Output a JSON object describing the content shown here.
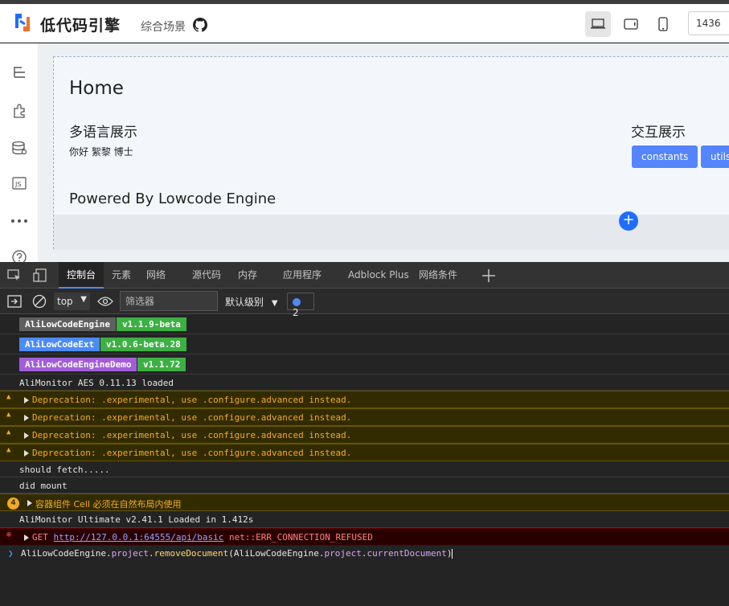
{
  "header": {
    "app_title": "低代码引擎",
    "scene_label": "综合场景",
    "canvas_width": "1436"
  },
  "canvas": {
    "home_title": "Home",
    "multilang_title": "多语言展示",
    "multilang_text": "你好  絮黎 博士",
    "interaction_title": "交互展示",
    "buttons": [
      "constants",
      "utils"
    ],
    "powered_text": "Powered By Lowcode Engine",
    "add_symbol": "+"
  },
  "devtools": {
    "tabs": [
      "控制台",
      "元素",
      "网络",
      "源代码",
      "内存",
      "应用程序",
      "Adblock Plus",
      "网络条件"
    ],
    "active_tab": "控制台",
    "context": "top",
    "filter_placeholder": "筛选器",
    "level": "默认级别",
    "issue_count": "2"
  },
  "console": {
    "badges": [
      {
        "name": "AliLowCodeEngine",
        "version": "v1.1.9-beta",
        "name_color": "#606060",
        "version_color": "#3cb043"
      },
      {
        "name": "AliLowCodeExt",
        "version": "v1.0.6-beta.28",
        "name_color": "#4c8bf5",
        "version_color": "#3cb043"
      },
      {
        "name": "AliLowCodeEngineDemo",
        "version": "v1.1.72",
        "name_color": "#a25ed8",
        "version_color": "#3cb043"
      }
    ],
    "monitor_aes": "AliMonitor AES 0.11.13 loaded",
    "deprecations": [
      "Deprecation: .experimental, use .configure.advanced instead.",
      "Deprecation: .experimental, use .configure.advanced instead.",
      "Deprecation: .experimental, use .configure.advanced instead.",
      "Deprecation: .experimental, use .configure.advanced instead."
    ],
    "should_fetch": "should fetch.....",
    "did_mount": "did mount",
    "grouped_warning_count": "4",
    "grouped_warning": "容器组件 Cell 必须在自然布局内使用",
    "monitor_ultimate": "AliMonitor Ultimate v2.41.1 Loaded in 1.412s",
    "error_method": "GET",
    "error_url": "http://127.0.0.1:64555/api/basic",
    "error_code": "net::ERR_CONNECTION_REFUSED",
    "prompt": {
      "obj1": "AliLowCodeEngine",
      "prop1": "project",
      "fn": "removeDocument",
      "obj2": "AliLowCodeEngine",
      "prop2": "project",
      "prop3": "currentDocument"
    }
  }
}
